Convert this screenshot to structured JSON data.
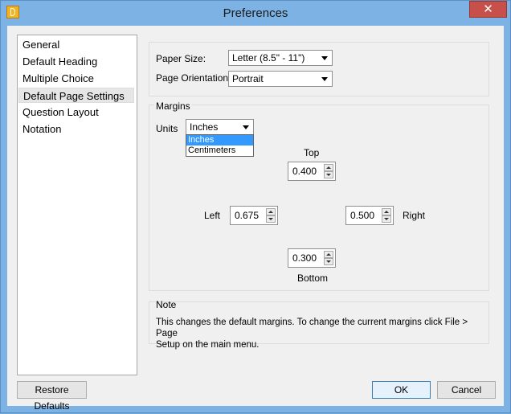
{
  "window": {
    "title": "Preferences",
    "close_glyph": "✕"
  },
  "nav": {
    "items": [
      {
        "label": "General"
      },
      {
        "label": "Default Heading"
      },
      {
        "label": "Multiple Choice"
      },
      {
        "label": "Default Page Settings"
      },
      {
        "label": "Question Layout"
      },
      {
        "label": "Notation"
      }
    ],
    "selected": "Default Page Settings"
  },
  "page": {
    "paper_size_label": "Paper Size:",
    "paper_size_value": "Letter (8.5\" - 11\")",
    "orientation_label": "Page Orientation:",
    "orientation_value": "Portrait"
  },
  "margins": {
    "group_label": "Margins",
    "units_label": "Units",
    "units_value": "Inches",
    "units_options": [
      "Inches",
      "Centimeters"
    ],
    "top_label": "Top",
    "top_value": "0.400",
    "left_label": "Left",
    "left_value": "0.675",
    "right_label": "Right",
    "right_value": "0.500",
    "bottom_label": "Bottom",
    "bottom_value": "0.300"
  },
  "note": {
    "group_label": "Note",
    "line1": "This changes the default margins.  To change the current margins click File > Page",
    "line2": "Setup on the main menu."
  },
  "buttons": {
    "restore": "Restore Defaults",
    "ok": "OK",
    "cancel": "Cancel"
  },
  "colors": {
    "title_bar": "#7db2e4",
    "close_button": "#c7504b",
    "selection": "#3399ff",
    "dialog_bg": "#f0f0f0"
  },
  "icons": {
    "app": "app-icon",
    "close": "close-icon",
    "dropdown_arrow": "chevron-down-icon",
    "spin_up": "spin-up-icon",
    "spin_down": "spin-down-icon"
  }
}
